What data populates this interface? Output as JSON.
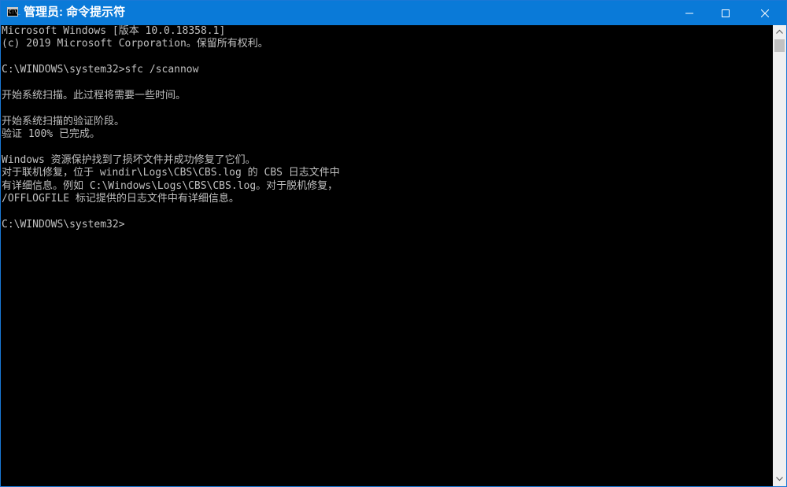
{
  "window": {
    "title": "管理员: 命令提示符",
    "icon": "cmd-icon",
    "icon_text": "C:\\_",
    "accent_color": "#0a7ad8"
  },
  "controls": {
    "minimize": "minimize-icon",
    "maximize": "maximize-icon",
    "close": "close-icon"
  },
  "console": {
    "lines": [
      "Microsoft Windows [版本 10.0.18358.1]",
      "(c) 2019 Microsoft Corporation。保留所有权利。",
      "",
      "C:\\WINDOWS\\system32>sfc /scannow",
      "",
      "开始系统扫描。此过程将需要一些时间。",
      "",
      "开始系统扫描的验证阶段。",
      "验证 100% 已完成。",
      "",
      "Windows 资源保护找到了损坏文件并成功修复了它们。",
      "对于联机修复，位于 windir\\Logs\\CBS\\CBS.log 的 CBS 日志文件中",
      "有详细信息。例如 C:\\Windows\\Logs\\CBS\\CBS.log。对于脱机修复，",
      "/OFFLOGFILE 标记提供的日志文件中有详细信息。",
      "",
      "C:\\WINDOWS\\system32>"
    ]
  }
}
